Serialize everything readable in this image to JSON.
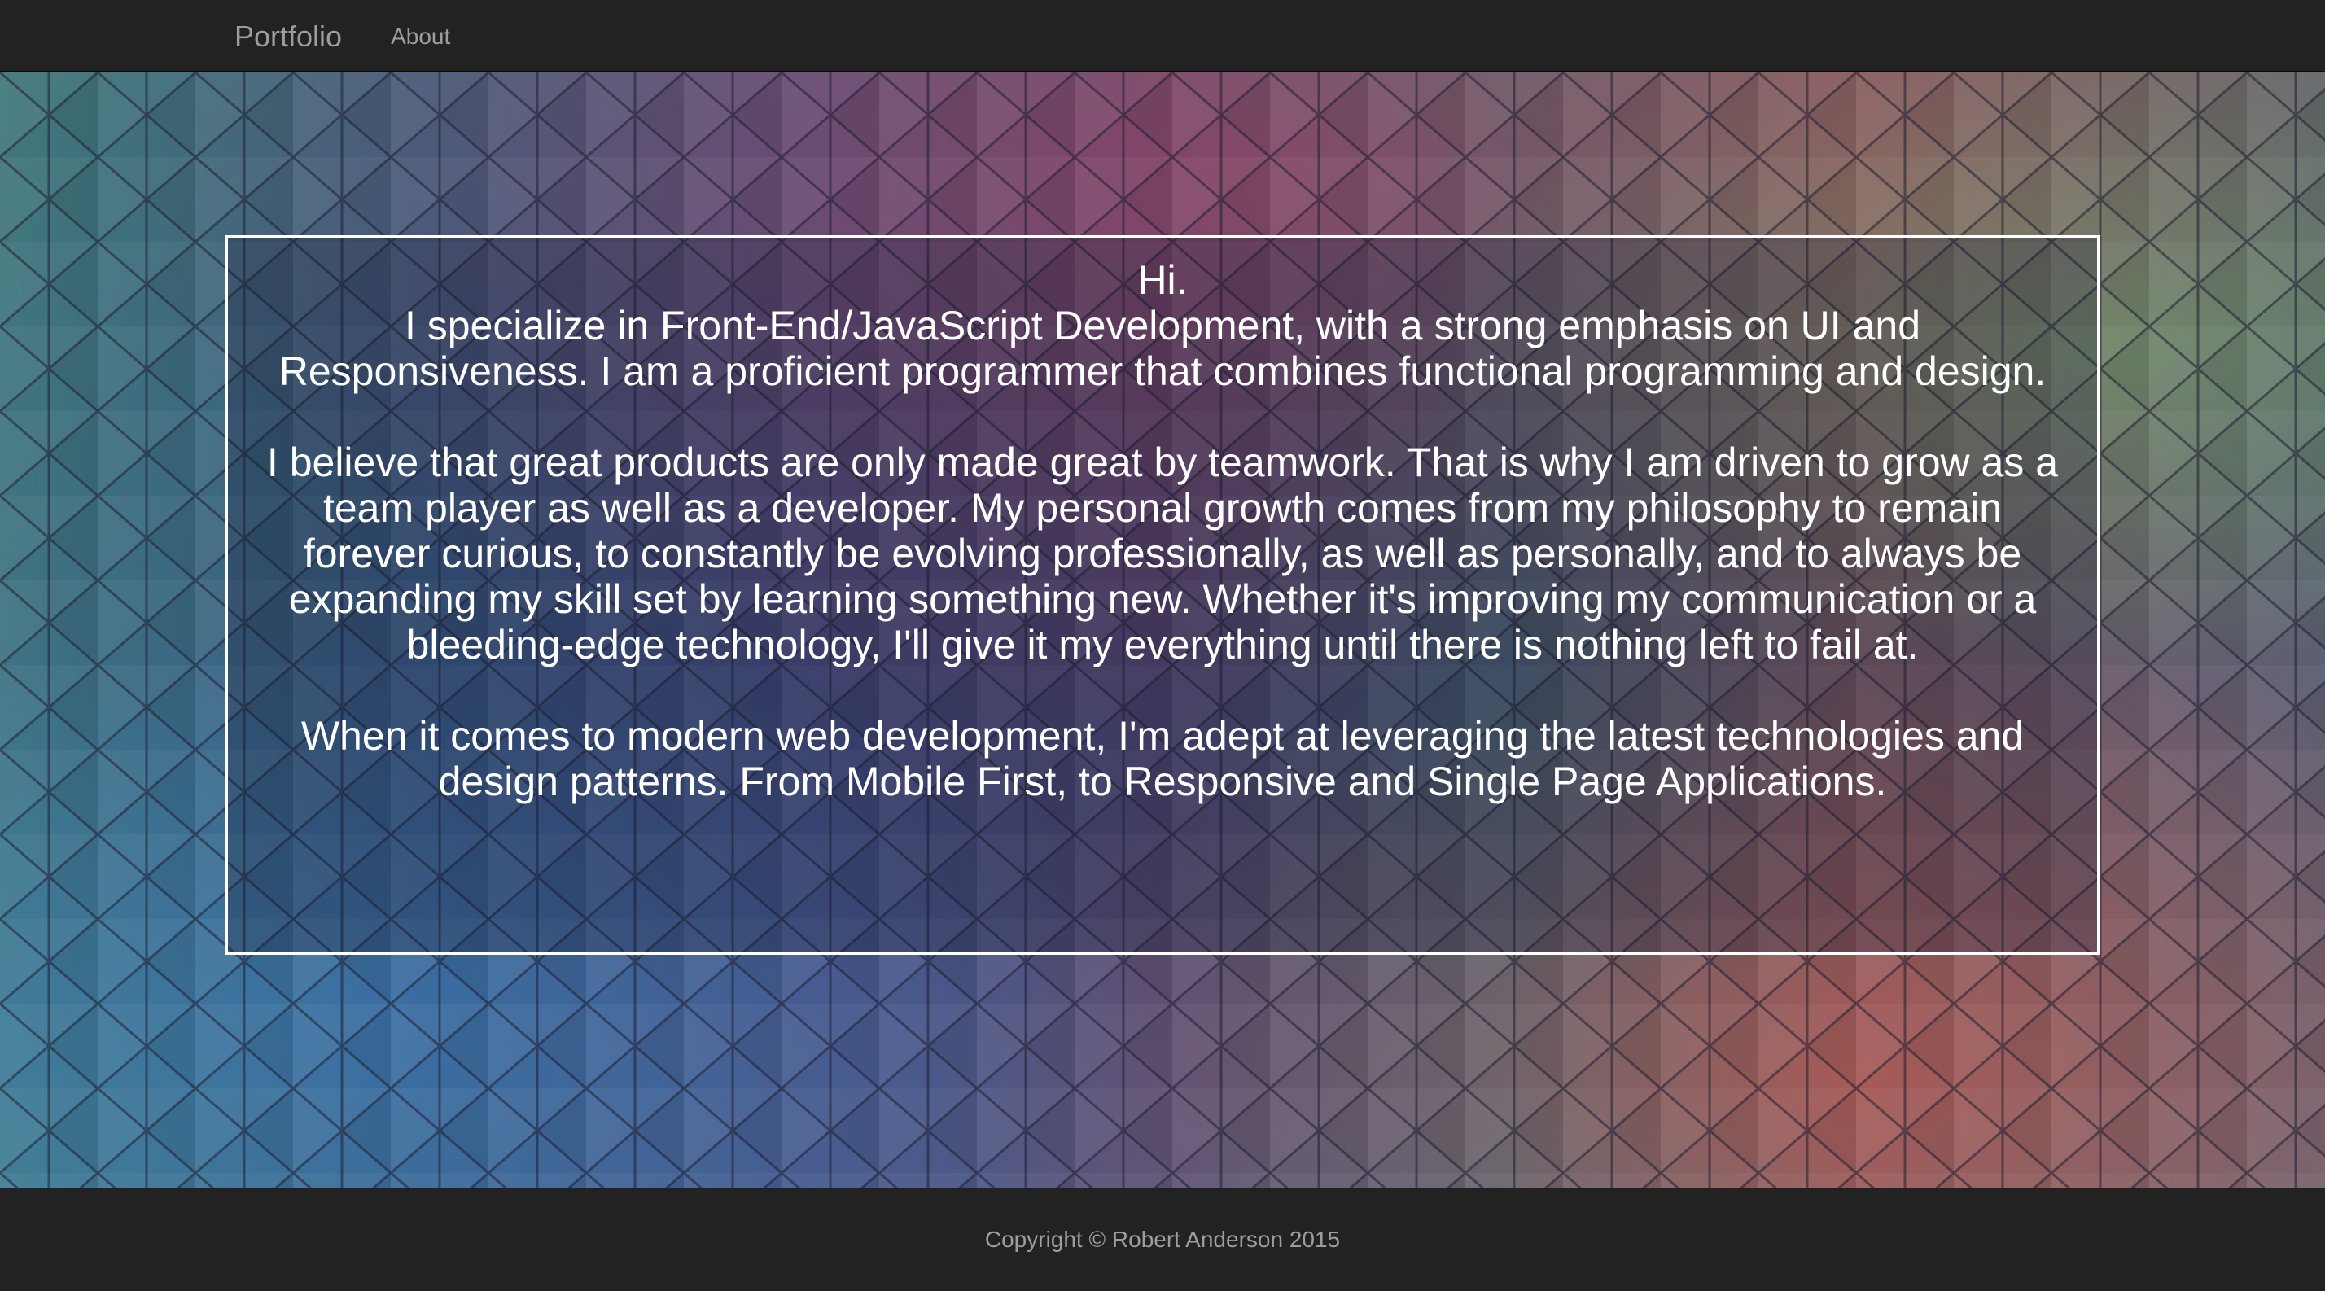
{
  "nav": {
    "brand": "Portfolio",
    "links": [
      "About"
    ]
  },
  "hero": {
    "greeting": "Hi.",
    "paragraphs": [
      "I specialize in Front-End/JavaScript Development, with a strong emphasis on UI and Responsiveness. I am a proficient programmer that combines functional programming and design.",
      "I believe that great products are only made great by teamwork. That is why I am driven to grow as a team player as well as a developer. My personal growth comes from my philosophy to remain forever curious, to constantly be evolving professionally, as well as personally, and to always be expanding my skill set by learning something new. Whether it's improving my communication or a bleeding-edge technology, I'll give it my everything until there is nothing left to fail at.",
      "When it comes to modern web development, I'm adept at leveraging the latest technologies and design patterns. From Mobile First, to Responsive and Single Page Applications."
    ]
  },
  "footer": {
    "copyright": "Copyright © Robert Anderson 2015"
  },
  "colors": {
    "navbar": "#222222",
    "nav_text": "#9d9d9d",
    "content_text": "#ffffff",
    "content_border": "#ffffff"
  }
}
